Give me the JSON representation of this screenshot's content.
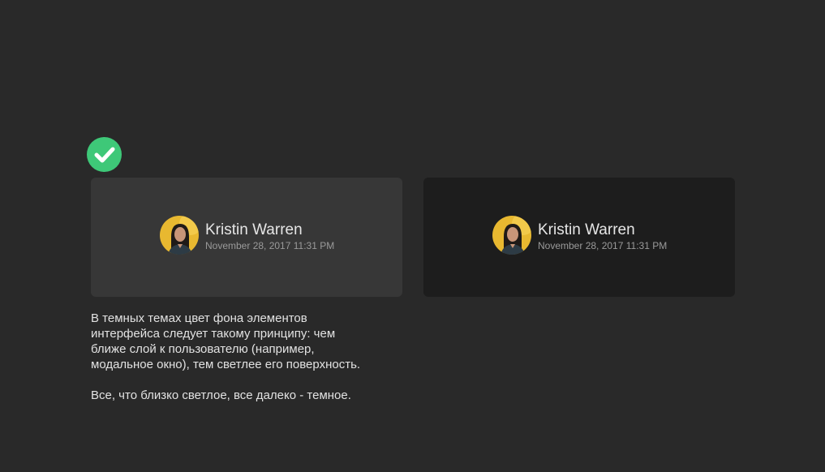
{
  "badge": {
    "icon": "checkmark-icon",
    "color": "#3ec878"
  },
  "cards": [
    {
      "variant": "light",
      "background": "#373737",
      "user": {
        "name": "Kristin Warren",
        "date": "November 28, 2017 11:31 PM",
        "avatar": "user-avatar"
      }
    },
    {
      "variant": "dark",
      "background": "#1d1d1d",
      "user": {
        "name": "Kristin Warren",
        "date": "November 28, 2017 11:31 PM",
        "avatar": "user-avatar"
      }
    }
  ],
  "description": {
    "paragraph1": "В темных темах цвет фона элементов интерфейса следует такому принципу: чем ближе слой к пользователю (например, модальное окно), тем светлее его поверхность.",
    "paragraph2": "Все, что близко светлое, все далеко - темное."
  },
  "colors": {
    "page_background": "#292929"
  }
}
